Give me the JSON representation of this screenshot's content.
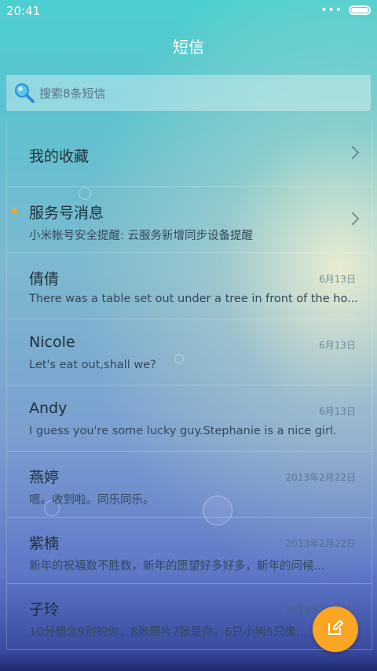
{
  "status_bar": {
    "time": "20:41",
    "more": "•••"
  },
  "header": {
    "title": "短信"
  },
  "search": {
    "placeholder": "搜索8条短信"
  },
  "conversations": [
    {
      "name": "我的收藏",
      "snippet": "",
      "date": ""
    },
    {
      "name": "服务号消息",
      "snippet": "小米帐号安全提醒: 云服务新增同步设备提醒",
      "date": "",
      "unread": true
    },
    {
      "name": "倩倩",
      "snippet": "There was a table set out under a tree in front of the ho...",
      "date": "6月13日"
    },
    {
      "name": "Nicole",
      "snippet": "Let's eat out,shall we?",
      "date": "6月13日"
    },
    {
      "name": "Andy",
      "snippet": "I guess you're some lucky guy.Stephanie is a nice girl.",
      "date": "6月13日"
    },
    {
      "name": "燕婷",
      "snippet": "嗯。收到啦。同乐同乐。",
      "date": "2013年2月22日"
    },
    {
      "name": "紫楠",
      "snippet": "新年的祝福数不胜数，新年的愿望好多好多，新年的问候...",
      "date": "2013年2月22日"
    },
    {
      "name": "子玲",
      "snippet": "10分想念9别的你，8张照片7张是你，6只小狗5只像...",
      "date": "2013年2月22日"
    }
  ],
  "colors": {
    "accent": "#f8a623",
    "unread_dot": "#f5a623"
  },
  "icons": {
    "search": "search-icon",
    "compose": "compose-icon",
    "chevron": "chevron-right-icon"
  }
}
